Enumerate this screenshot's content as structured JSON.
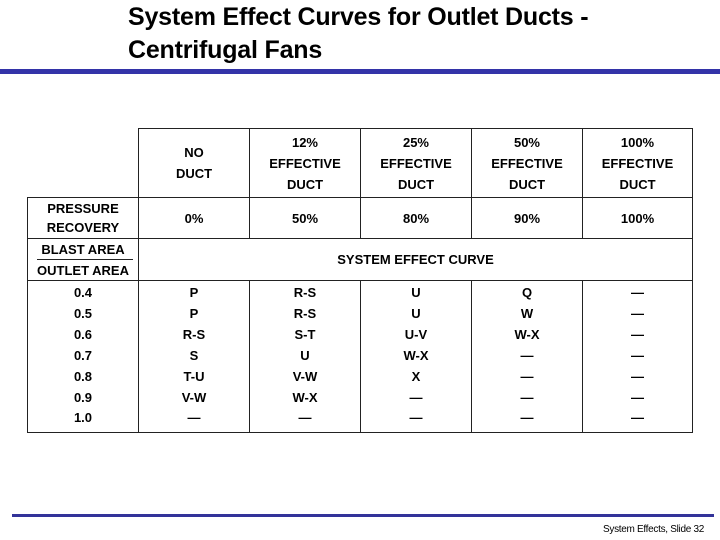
{
  "slide": {
    "title_line1": "System Effect Curves for Outlet Ducts -",
    "title_line2": "Centrifugal Fans",
    "footer": "System Effects, Slide 32",
    "accent_color": "#3333a8"
  },
  "table": {
    "columns": [
      {
        "line1": "NO",
        "line2": "DUCT",
        "line3": ""
      },
      {
        "line1": "12%",
        "line2": "EFFECTIVE",
        "line3": "DUCT"
      },
      {
        "line1": "25%",
        "line2": "EFFECTIVE",
        "line3": "DUCT"
      },
      {
        "line1": "50%",
        "line2": "EFFECTIVE",
        "line3": "DUCT"
      },
      {
        "line1": "100%",
        "line2": "EFFECTIVE",
        "line3": "DUCT"
      }
    ],
    "pressure_recovery_label_line1": "PRESSURE",
    "pressure_recovery_label_line2": "RECOVERY",
    "pressure_recovery": [
      "0%",
      "50%",
      "80%",
      "90%",
      "100%"
    ],
    "ratio_numerator": "BLAST AREA",
    "ratio_denominator": "OUTLET AREA",
    "span_header": "SYSTEM EFFECT CURVE",
    "rows": [
      {
        "ratio": "0.4",
        "values": [
          "P",
          "R-S",
          "U",
          "Q",
          "—"
        ]
      },
      {
        "ratio": "0.5",
        "values": [
          "P",
          "R-S",
          "U",
          "W",
          "—"
        ]
      },
      {
        "ratio": "0.6",
        "values": [
          "R-S",
          "S-T",
          "U-V",
          "W-X",
          "—"
        ]
      },
      {
        "ratio": "0.7",
        "values": [
          "S",
          "U",
          "W-X",
          "—",
          "—"
        ]
      },
      {
        "ratio": "0.8",
        "values": [
          "T-U",
          "V-W",
          "X",
          "—",
          "—"
        ]
      },
      {
        "ratio": "0.9",
        "values": [
          "V-W",
          "W-X",
          "—",
          "—",
          "—"
        ]
      },
      {
        "ratio": "1.0",
        "values": [
          "—",
          "—",
          "—",
          "—",
          "—"
        ]
      }
    ]
  }
}
